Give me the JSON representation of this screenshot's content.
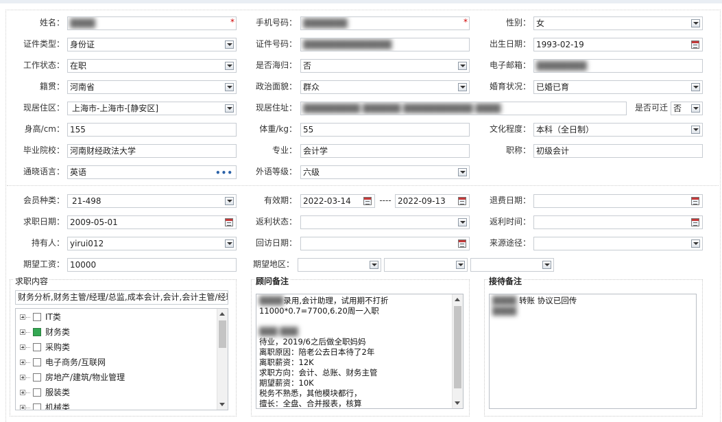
{
  "personal": {
    "name": {
      "label": "姓名：",
      "value": "████"
    },
    "phone": {
      "label": "手机号码：",
      "value": "███████"
    },
    "gender": {
      "label": "性别：",
      "value": "女"
    },
    "id_type": {
      "label": "证件类型：",
      "value": "身份证"
    },
    "id_number": {
      "label": "证件号码：",
      "value": "██████████████"
    },
    "birth_date": {
      "label": "出生日期：",
      "value": "1993-02-19"
    },
    "work_status": {
      "label": "工作状态：",
      "value": "在职"
    },
    "overseas": {
      "label": "是否海归：",
      "value": "否"
    },
    "email": {
      "label": "电子邮箱：",
      "value": "████████"
    },
    "native_place": {
      "label": "籍贯：",
      "value": "河南省"
    },
    "political": {
      "label": "政治面貌：",
      "value": "群众"
    },
    "marital": {
      "label": "婚育状况：",
      "value": "已婚已育"
    },
    "residence_area": {
      "label": "现居住区：",
      "value": "上海市-上海市-[静安区]"
    },
    "residence_address": {
      "label": "现居住址：",
      "value": "█████████ ██████  ███████████ ████"
    },
    "relocatable": {
      "label": "是否可迁",
      "value": "否"
    },
    "height": {
      "label": "身高/cm：",
      "value": "155"
    },
    "weight": {
      "label": "体重/kg：",
      "value": "55"
    },
    "education": {
      "label": "文化程度：",
      "value": "本科（全日制）"
    },
    "school": {
      "label": "毕业院校：",
      "value": "河南财经政法大学"
    },
    "major": {
      "label": "专业：",
      "value": "会计学"
    },
    "title": {
      "label": "职称：",
      "value": "初级会计"
    },
    "language": {
      "label": "通晓语言：",
      "value": "英语"
    },
    "language_level": {
      "label": "外语等级：",
      "value": "六级"
    }
  },
  "membership": {
    "member_type": {
      "label": "会员种类：",
      "value": "21-498"
    },
    "valid_period": {
      "label": "有效期：",
      "start": "2022-03-14",
      "separator": "----",
      "end": "2022-09-13"
    },
    "refund_date": {
      "label": "退费日期：",
      "value": ""
    },
    "job_date": {
      "label": "求职日期：",
      "value": "2009-05-01"
    },
    "rebate_status": {
      "label": "返利状态：",
      "value": ""
    },
    "rebate_time": {
      "label": "返利时间：",
      "value": ""
    },
    "holder": {
      "label": "持有人：",
      "value": "yirui012"
    },
    "visit_date": {
      "label": "回访日期：",
      "value": ""
    },
    "source": {
      "label": "来源途径：",
      "value": ""
    },
    "expected_salary": {
      "label": "期望工资：",
      "value": "10000"
    },
    "expected_region": {
      "label": "期望地区：",
      "value1": "",
      "value2": "",
      "value3": ""
    }
  },
  "job_content": {
    "title": "求职内容",
    "summary": "财务分析,财务主管/经理/总监,成本会计,会计,会计主管/经理",
    "tree": [
      {
        "label": "IT类",
        "checked": false
      },
      {
        "label": "财务类",
        "checked": true
      },
      {
        "label": "采购类",
        "checked": false
      },
      {
        "label": "电子商务/互联网",
        "checked": false
      },
      {
        "label": "房地产/建筑/物业管理",
        "checked": false
      },
      {
        "label": "服装类",
        "checked": false
      },
      {
        "label": "机械类",
        "checked": false
      }
    ]
  },
  "advisor_note": {
    "title": "顾问备注",
    "masked_prefix": "████",
    "line1": "录用,会计助理，试用期不打折",
    "line2": "11000*0.7=7700,6.20周一入职",
    "masked_line": "███ ███",
    "line3": "待业，2019/6之后做全职妈妈",
    "line4": "离职原因：陪老公去日本待了2年",
    "line5": "离职薪资：12K",
    "line6": "求职方向：会计、总账、财务主管",
    "line7": "期望薪资：10K",
    "line8": "税务不熟悉，其他模块都行，",
    "line9": "擅长：全盘、合并报表，核算"
  },
  "reception_note": {
    "title": "接待备注",
    "masked_prefix": "████",
    "line1": "转账 协议已回传",
    "masked_line": "████"
  }
}
